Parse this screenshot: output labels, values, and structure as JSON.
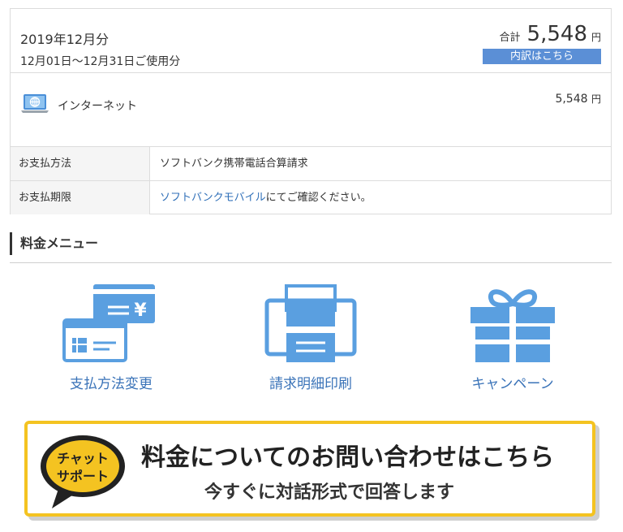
{
  "bill": {
    "month": "2019年12月分",
    "range": "12月01日～12月31日ご使用分",
    "total_label": "合計",
    "total_amount": "5,548",
    "currency": "円",
    "breakdown_button": "内訳はこちら",
    "item_label": "インターネット",
    "item_amount": "5,548",
    "item_currency": "円"
  },
  "payment": {
    "method_label": "お支払方法",
    "method_value": "ソフトバンク携帯電話合算請求",
    "due_label": "お支払期限",
    "due_link": "ソフトバンクモバイル",
    "due_suffix": "にてご確認ください。"
  },
  "menu": {
    "title": "料金メニュー",
    "items": [
      {
        "label": "支払方法変更",
        "icon": "payment-card-icon"
      },
      {
        "label": "請求明細印刷",
        "icon": "printer-icon"
      },
      {
        "label": "キャンペーン",
        "icon": "gift-icon"
      }
    ]
  },
  "banner": {
    "bubble_line1": "チャット",
    "bubble_line2": "サポート",
    "main_text": "料金についてのお問い合わせはこちら",
    "sub_text": "今すぐに対話形式で回答します"
  },
  "colors": {
    "accent_blue": "#5b8fd6",
    "link_blue": "#2f6fb8",
    "icon_blue": "#5a9fe0",
    "banner_yellow": "#f4c321"
  }
}
